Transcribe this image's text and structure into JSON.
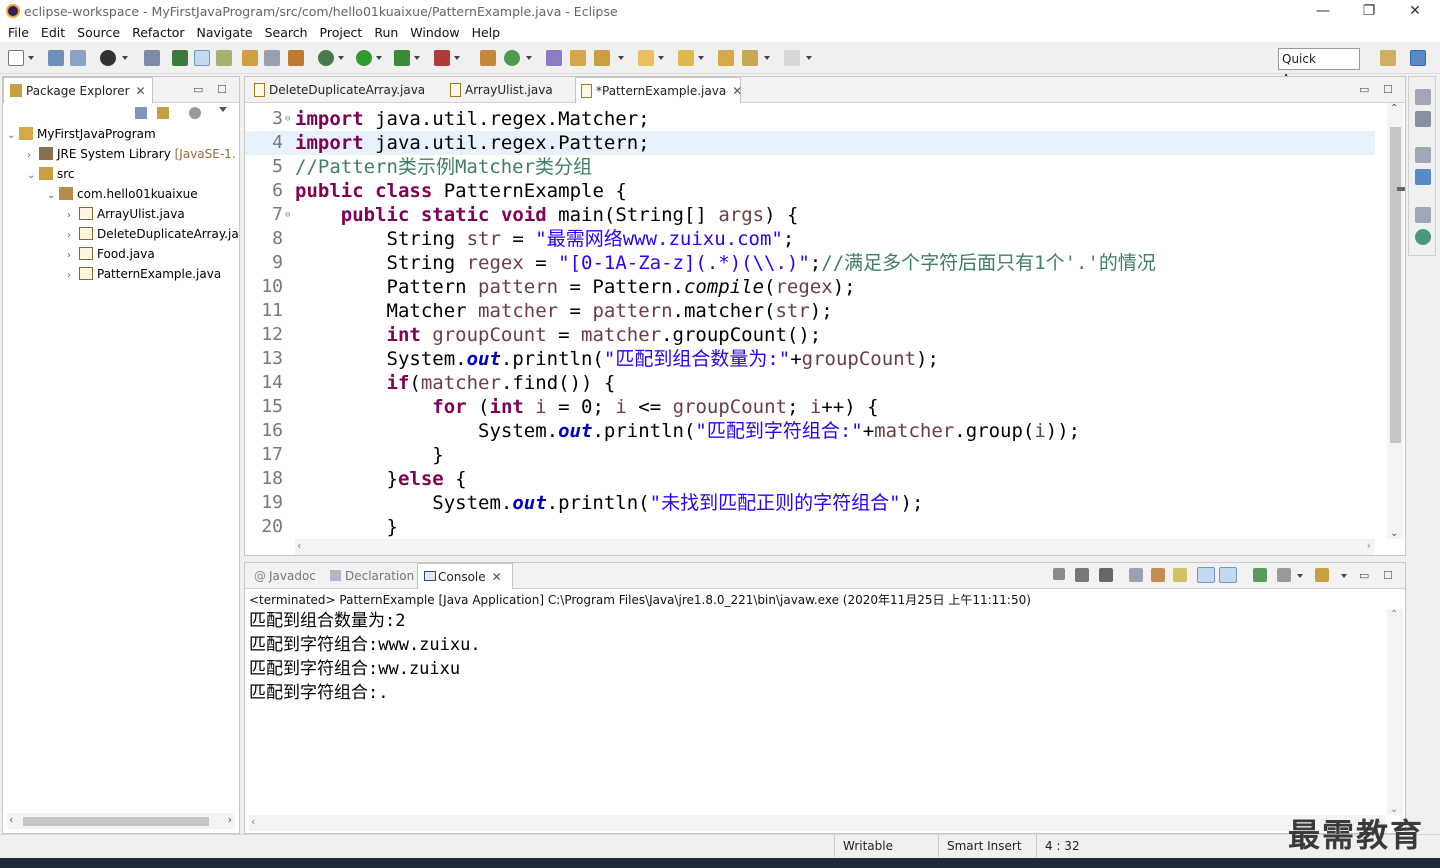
{
  "window": {
    "title": "eclipse-workspace - MyFirstJavaProgram/src/com/hello01kuaixue/PatternExample.java - Eclipse",
    "minimize": "—",
    "maximize": "❐",
    "close": "✕"
  },
  "menu": [
    "File",
    "Edit",
    "Source",
    "Refactor",
    "Navigate",
    "Search",
    "Project",
    "Run",
    "Window",
    "Help"
  ],
  "quick_access": "Quick Access",
  "package_explorer": {
    "tab_label": "Package Explorer",
    "tree": [
      {
        "label": "MyFirstJavaProgram",
        "icon": "project-icon"
      },
      {
        "label": "JRE System Library",
        "decoration": "[JavaSE-1.",
        "icon": "library-icon"
      },
      {
        "label": "src",
        "icon": "source-folder-icon"
      },
      {
        "label": "com.hello01kuaixue",
        "icon": "package-icon"
      },
      {
        "label": "ArrayUlist.java",
        "icon": "java-file-icon"
      },
      {
        "label": "DeleteDuplicateArray.ja",
        "icon": "java-file-icon"
      },
      {
        "label": "Food.java",
        "icon": "java-file-icon"
      },
      {
        "label": "PatternExample.java",
        "icon": "java-file-icon"
      }
    ]
  },
  "editor": {
    "tabs": [
      {
        "label": "DeleteDuplicateArray.java",
        "active": false
      },
      {
        "label": "ArrayUlist.java",
        "active": false
      },
      {
        "label": "*PatternExample.java",
        "active": true
      }
    ],
    "line_numbers": [
      "3",
      "4",
      "5",
      "6",
      "7",
      "8",
      "9",
      "10",
      "11",
      "12",
      "13",
      "14",
      "15",
      "16",
      "17",
      "18",
      "19",
      "20"
    ]
  },
  "console_panel": {
    "tabs": [
      "Javadoc",
      "Declaration",
      "Console"
    ],
    "header": "<terminated> PatternExample [Java Application] C:\\Program Files\\Java\\jre1.8.0_221\\bin\\javaw.exe (2020年11月25日 上午11:11:50)",
    "output": [
      "匹配到组合数量为:2",
      "匹配到字符组合:www.zuixu.",
      "匹配到字符组合:ww.zuixu",
      "匹配到字符组合:."
    ]
  },
  "status": {
    "writable": "Writable",
    "insert_mode": "Smart Insert",
    "position": "4 : 32"
  },
  "watermark": "最需教育"
}
